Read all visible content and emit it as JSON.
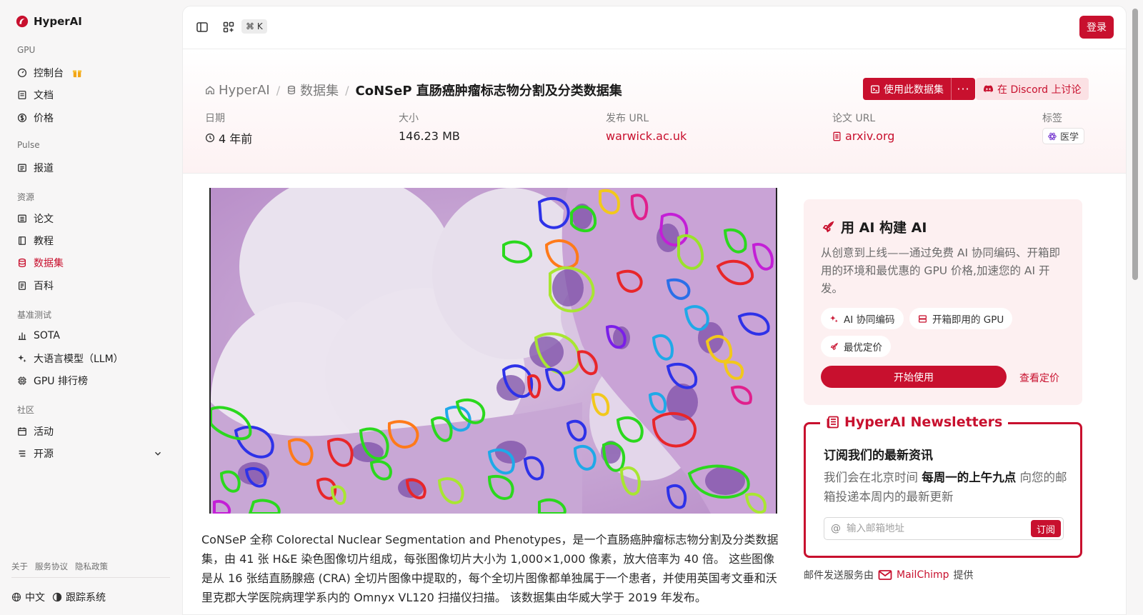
{
  "sidebar": {
    "brand": "HyperAI",
    "sections": {
      "gpu": "GPU",
      "pulse": "Pulse",
      "resources": "资源",
      "benchmarks": "基准测试",
      "community": "社区"
    },
    "items": {
      "console": "控制台",
      "docs": "文档",
      "pricing": "价格",
      "news": "报道",
      "papers": "论文",
      "tutorials": "教程",
      "datasets": "数据集",
      "wiki": "百科",
      "sota": "SOTA",
      "llm": "大语言模型（LLM）",
      "gpu_rank": "GPU 排行榜",
      "events": "活动",
      "opensource": "开源"
    },
    "footer": {
      "about": "关于",
      "terms": "服务协议",
      "privacy": "隐私政策"
    },
    "bottom": {
      "language": "中文",
      "tracking": "跟踪系统"
    }
  },
  "topbar": {
    "shortcut": "⌘ K",
    "login": "登录"
  },
  "breadcrumb": {
    "home": "HyperAI",
    "datasets": "数据集",
    "current": "CoNSeP 直肠癌肿瘤标志物分割及分类数据集"
  },
  "actions": {
    "use_dataset": "使用此数据集",
    "more": "···",
    "discord": "在 Discord 上讨论"
  },
  "meta": {
    "date_label": "日期",
    "date_value": "4 年前",
    "size_label": "大小",
    "size_value": "146.23 MB",
    "release_label": "发布 URL",
    "release_value": "warwick.ac.uk",
    "paper_label": "论文 URL",
    "paper_value": "arxiv.org",
    "tags_label": "标签",
    "tag_value": "医学"
  },
  "description": "CoNSeP 全称 Colorectal Nuclear Segmentation and Phenotypes，是一个直肠癌肿瘤标志物分割及分类数据集，由 41 张 H&E 染色图像切片组成，每张图像切片大小为 1,000×1,000 像素，放大倍率为 40 倍。 这些图像是从 16 张结直肠腺癌 (CRA) 全切片图像中提取的，每个全切片图像都单独属于一个患者，并使用英国考文垂和沃里克郡大学医院病理学系内的 Omnyx VL120 扫描仪扫描。 该数据集由华威大学于 2019 年发布。",
  "promo": {
    "title": "用 AI 构建 AI",
    "text": "从创意到上线——通过免费 AI 协同编码、开箱即用的环境和最优惠的 GPU 价格,加速您的 AI 开发。",
    "pill_1": "AI 协同编码",
    "pill_2": "开箱即用的 GPU",
    "pill_3": "最优定价",
    "start": "开始使用",
    "pricing": "查看定价"
  },
  "newsletter": {
    "title": "HyperAI Newsletters",
    "heading": "订阅我们的最新资讯",
    "text_pre": "我们会在北京时间 ",
    "text_bold": "每周一的上午九点",
    "text_post": " 向您的邮箱投递本周内的最新更新",
    "placeholder": "输入邮箱地址",
    "subscribe": "订阅",
    "note_pre": "邮件发送服务由",
    "note_brand": "MailChimp",
    "note_post": "提供"
  },
  "colors": {
    "accent": "#c8102e",
    "accent_soft": "#fbe1e4"
  },
  "icons": [
    "hyperai-logo",
    "gauge-icon",
    "doc-icon",
    "dollar-icon",
    "news-icon",
    "paper-icon",
    "book-icon",
    "database-icon",
    "wiki-icon",
    "bar-chart-icon",
    "sparkle-icon",
    "cpu-icon",
    "calendar-icon",
    "list-icon",
    "chevron-down-icon",
    "globe-icon",
    "target-icon",
    "sidebar-toggle-icon",
    "apps-icon",
    "home-icon",
    "clock-icon",
    "file-icon",
    "atom-icon",
    "rocket-icon",
    "server-icon",
    "mail-icon"
  ]
}
